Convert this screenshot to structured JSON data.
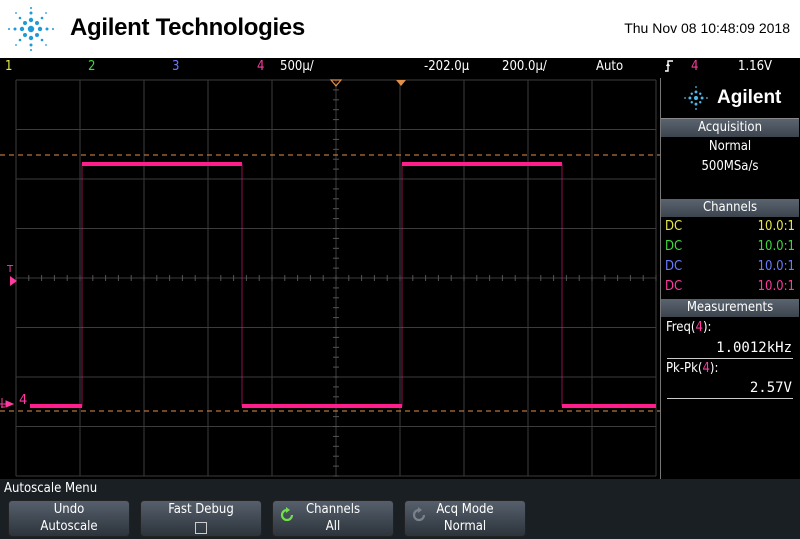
{
  "header": {
    "brand": "Agilent Technologies",
    "datetime": "Thu Nov 08 10:48:09 2018"
  },
  "status_bar": {
    "channels": [
      {
        "label": "1",
        "color": "#e8e84a"
      },
      {
        "label": "2",
        "color": "#3fd93f"
      },
      {
        "label": "3",
        "color": "#6a7cff"
      },
      {
        "label": "4",
        "color": "#ff3aa0"
      }
    ],
    "vertical_scale": "500µ/",
    "delay": "-202.0µ",
    "time_scale": "200.0µ/",
    "trigger_mode": "Auto",
    "trigger_icon": "rising-edge-icon",
    "trigger_source": "4",
    "trigger_level": "1.16V"
  },
  "waveform": {
    "channel": "4",
    "color": "#ff1e8c",
    "frequency_khz": 1.0012,
    "high_level_fraction": 0.195,
    "low_level_fraction": 0.81,
    "period_divisions": 5.0,
    "first_rising_division": 1.0,
    "high_duration_divisions": 2.5,
    "trigger_marker_label": "T",
    "ground_marker_label": "4"
  },
  "right_panel": {
    "logo_text": "Agilent",
    "acquisition": {
      "heading": "Acquisition",
      "mode": "Normal",
      "rate": "500MSa/s"
    },
    "channels": {
      "heading": "Channels",
      "rows": [
        {
          "coupling": "DC",
          "probe": "10.0:1",
          "color": "#e8e84a"
        },
        {
          "coupling": "DC",
          "probe": "10.0:1",
          "color": "#3fd93f"
        },
        {
          "coupling": "DC",
          "probe": "10.0:1",
          "color": "#6a7cff"
        },
        {
          "coupling": "DC",
          "probe": "10.0:1",
          "color": "#ff3aa0"
        }
      ]
    },
    "measurements": {
      "heading": "Measurements",
      "items": [
        {
          "name": "Freq(",
          "ch": "4",
          "close": "):",
          "value": "1.0012kHz"
        },
        {
          "name": "Pk-Pk(",
          "ch": "4",
          "close": "):",
          "value": "2.57V"
        }
      ]
    }
  },
  "softkey_menu": {
    "title": "Autoscale Menu",
    "buttons": [
      {
        "line1": "Undo",
        "line2": "Autoscale"
      },
      {
        "line1": "Fast Debug",
        "line2": ""
      },
      {
        "line1": "Channels",
        "line2": "All"
      },
      {
        "line1": "Acq Mode",
        "line2": "Normal"
      }
    ]
  }
}
